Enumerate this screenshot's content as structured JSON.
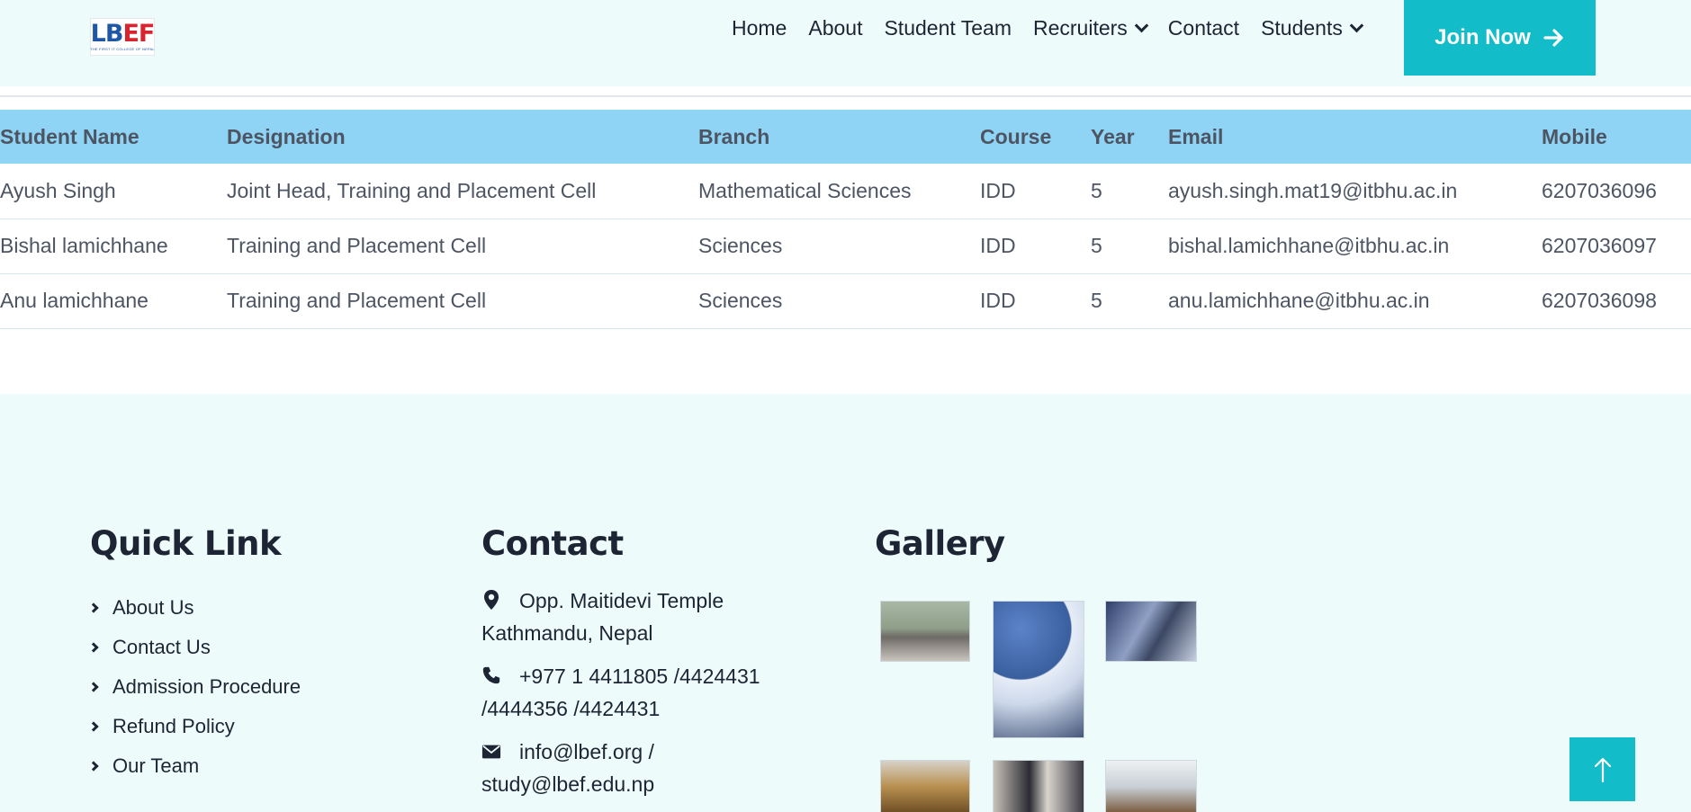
{
  "header": {
    "logo": {
      "mark_left": "LB",
      "mark_right": "EF",
      "tagline": "THE FIRST IT COLLEGE OF NEPAL"
    },
    "nav": {
      "home": "Home",
      "about": "About",
      "student_team": "Student Team",
      "recruiters": "Recruiters",
      "contact": "Contact",
      "students": "Students"
    },
    "join_label": "Join Now",
    "accent_color": "#12bcc9"
  },
  "table": {
    "headers": [
      "Student Name",
      "Designation",
      "Branch",
      "Course",
      "Year",
      "Email",
      "Mobile"
    ],
    "rows": [
      [
        "Ayush Singh",
        "Joint Head, Training and Placement Cell",
        "Mathematical Sciences",
        "IDD",
        "5",
        "ayush.singh.mat19@itbhu.ac.in",
        "6207036096"
      ],
      [
        "Bishal lamichhane",
        "Training and Placement Cell",
        "Sciences",
        "IDD",
        "5",
        "bishal.lamichhane@itbhu.ac.in",
        "6207036097"
      ],
      [
        "Anu lamichhane",
        "Training and Placement Cell",
        "Sciences",
        "IDD",
        "5",
        "anu.lamichhane@itbhu.ac.in",
        "6207036098"
      ]
    ],
    "header_color": "#8fd3f5"
  },
  "footer": {
    "quick_link": {
      "title": "Quick Link",
      "items": [
        "About Us",
        "Contact Us",
        "Admission Procedure",
        "Refund Policy",
        "Our Team"
      ]
    },
    "contact": {
      "title": "Contact",
      "address": "Opp. Maitidevi Temple Kathmandu, Nepal",
      "phone": "+977 1 4411805 /4424431 /4444356 /4424431",
      "email": "info@lbef.org / study@lbef.edu.np"
    },
    "gallery": {
      "title": "Gallery"
    }
  },
  "icons": {
    "nav_dropdown": "chevron-down-icon",
    "join_arrow": "arrow-right-icon",
    "list_bullet": "chevron-right-icon",
    "address": "map-pin-icon",
    "phone": "phone-icon",
    "email": "envelope-icon",
    "scroll_top": "arrow-up-icon"
  }
}
